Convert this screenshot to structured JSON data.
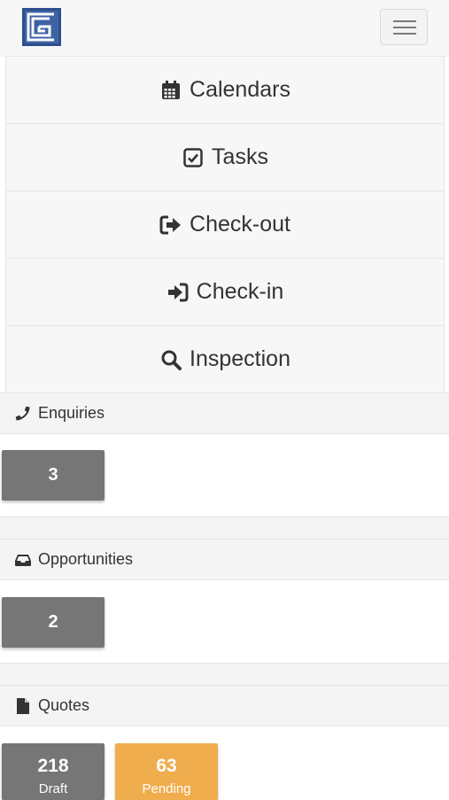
{
  "nav": {
    "items": [
      {
        "label": "Calendars",
        "icon": "calendar-icon"
      },
      {
        "label": "Tasks",
        "icon": "checkbox-icon"
      },
      {
        "label": "Check-out",
        "icon": "sign-out-icon"
      },
      {
        "label": "Check-in",
        "icon": "sign-in-icon"
      },
      {
        "label": "Inspection",
        "icon": "search-icon"
      }
    ]
  },
  "enquiries": {
    "title": "Enquiries",
    "count": "3"
  },
  "opportunities": {
    "title": "Opportunities",
    "count": "2"
  },
  "quotes": {
    "title": "Quotes",
    "draft_count": "218",
    "draft_label": "Draft",
    "pending_count": "63",
    "pending_label": "Pending"
  },
  "colors": {
    "tile_gray": "#767676",
    "tile_orange": "#f0ad4e",
    "logo_blue": "#3e63a5"
  }
}
